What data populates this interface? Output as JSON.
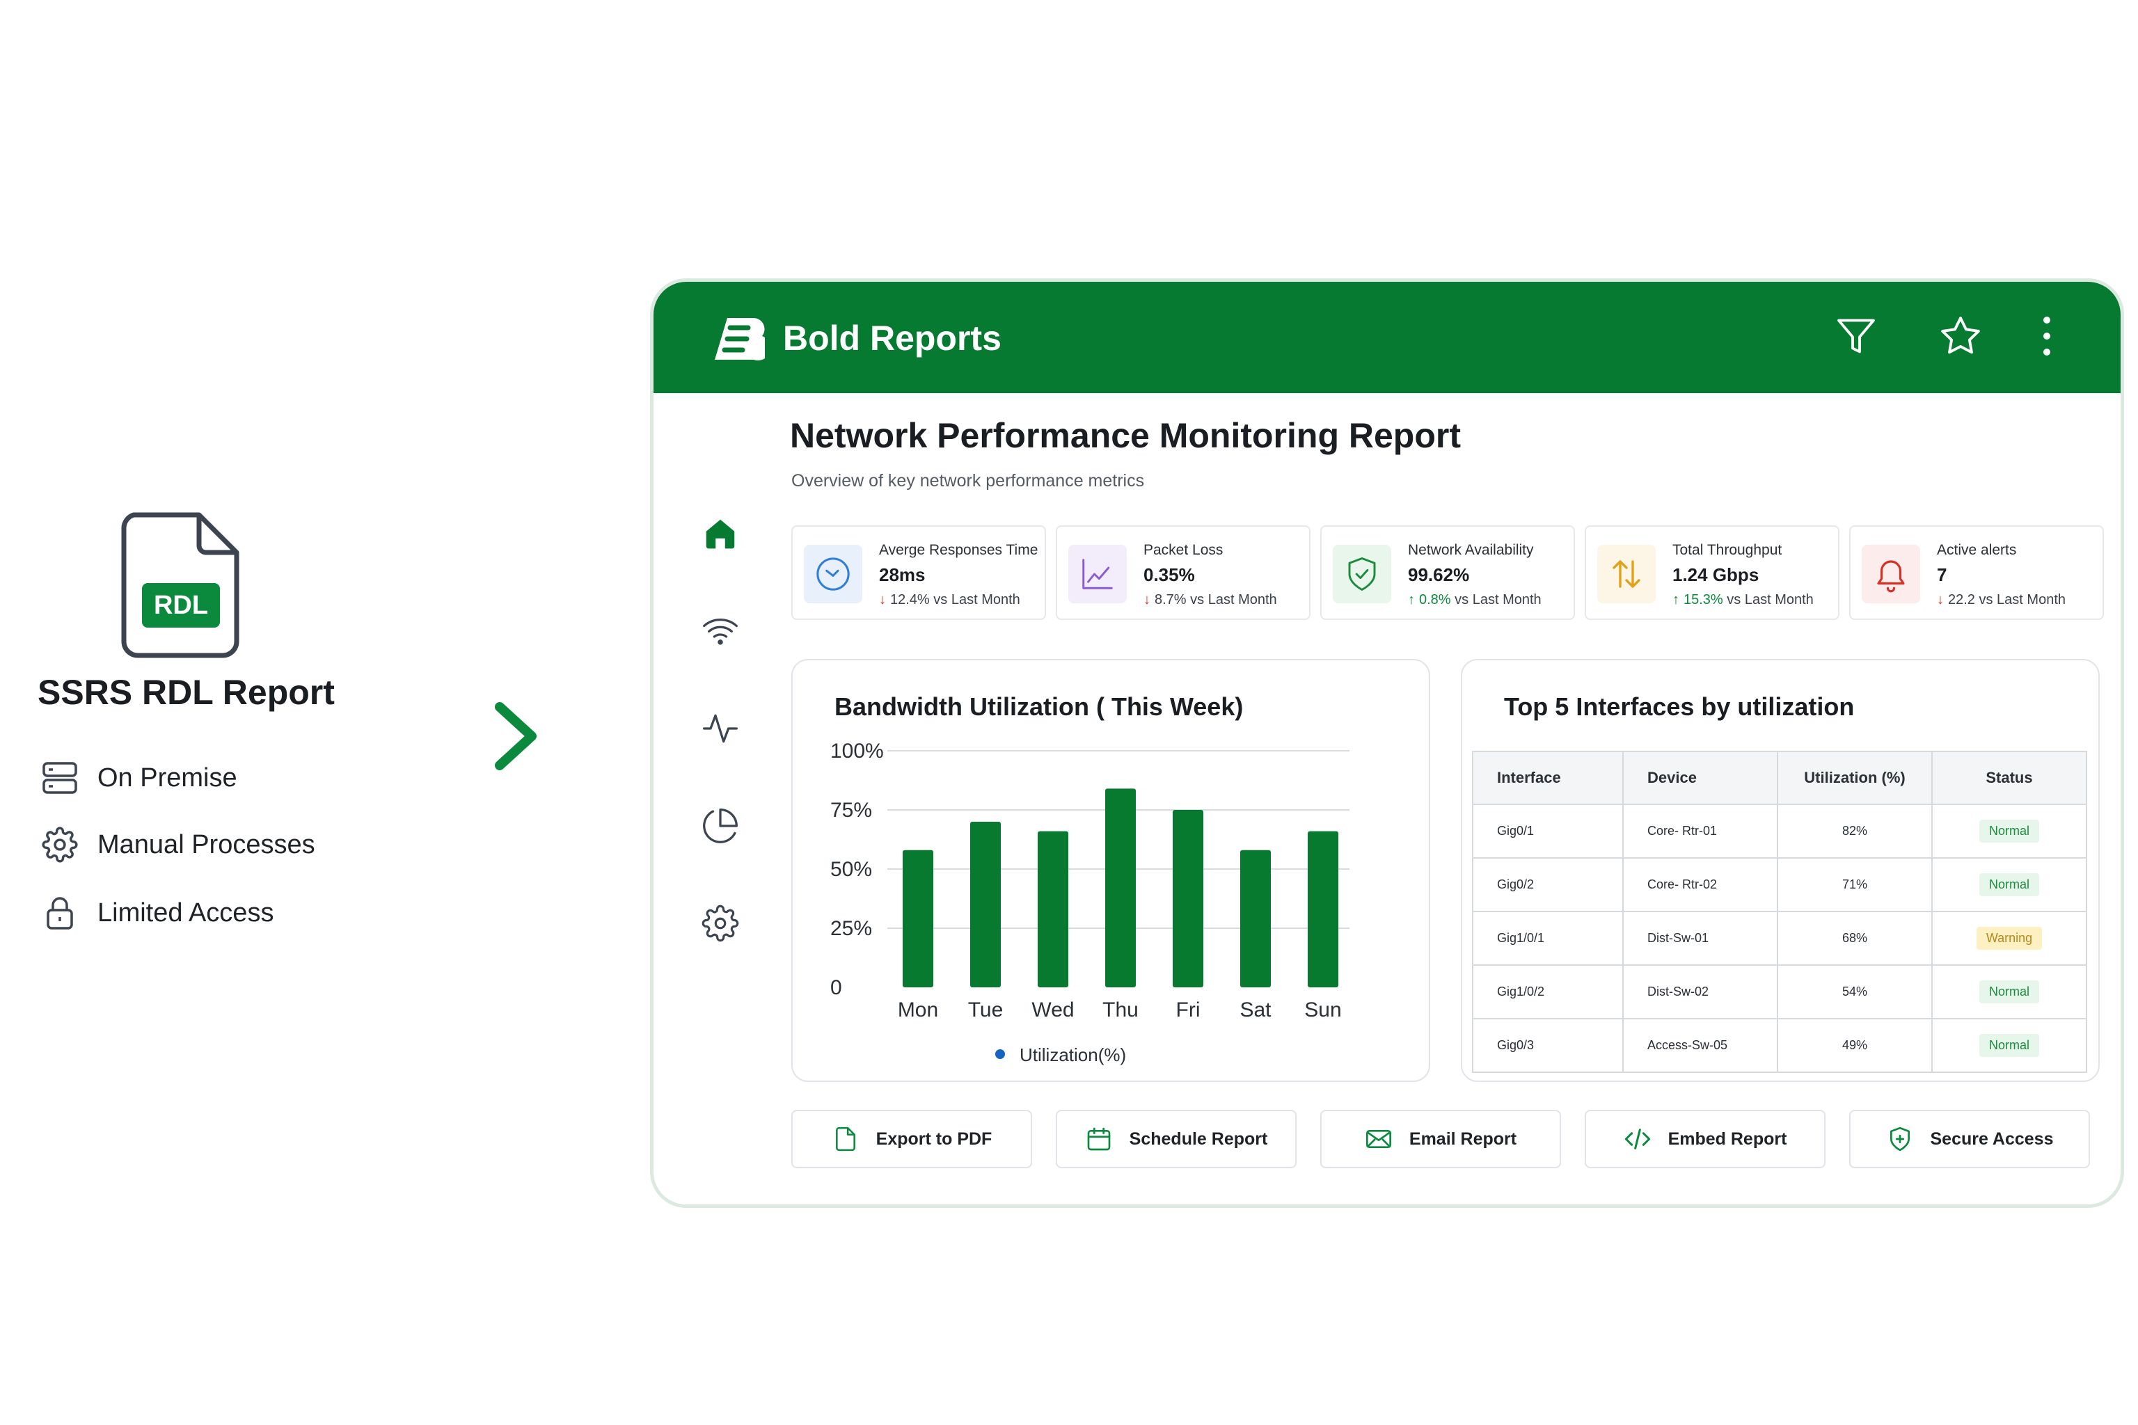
{
  "left": {
    "doc_badge": "RDL",
    "title": "SSRS RDL Report",
    "features": [
      {
        "icon": "server-icon",
        "label": "On Premise"
      },
      {
        "icon": "gear-icon",
        "label": "Manual Processes"
      },
      {
        "icon": "lock-icon",
        "label": "Limited Access"
      }
    ]
  },
  "app": {
    "title": "Bold Reports",
    "brand_color": "#077a32",
    "toolbar_icons": [
      "filter-icon",
      "star-icon",
      "more-vertical-icon"
    ],
    "sidebar_icons": [
      "home-icon",
      "wifi-icon",
      "activity-icon",
      "pie-chart-icon",
      "settings-icon"
    ]
  },
  "report": {
    "title": "Network Performance Monitoring Report",
    "subtitle": "Overview of key network performance metrics"
  },
  "kpis": [
    {
      "label": "Averge Responses Time",
      "value": "28ms",
      "delta": "12.4%",
      "delta_suffix": " vs Last Month",
      "direction": "down",
      "icon": "clock-icon"
    },
    {
      "label": "Packet Loss",
      "value": "0.35%",
      "delta": "8.7%",
      "delta_suffix": " vs Last Month",
      "direction": "down",
      "icon": "line-chart-icon"
    },
    {
      "label": "Network Availability",
      "value": "99.62%",
      "delta": "0.8%",
      "delta_suffix": " vs Last Month",
      "direction": "up",
      "icon": "shield-check-icon"
    },
    {
      "label": "Total Throughput",
      "value": "1.24 Gbps",
      "delta": "15.3%",
      "delta_suffix": " vs Last Month",
      "direction": "up",
      "icon": "transfer-icon"
    },
    {
      "label": "Active alerts",
      "value": "7",
      "delta": "22.2",
      "delta_suffix": " vs Last Month",
      "direction": "down",
      "icon": "bell-icon"
    }
  ],
  "chart_data": {
    "type": "bar",
    "title": "Bandwidth Utilization ( This Week)",
    "categories": [
      "Mon",
      "Tue",
      "Wed",
      "Thu",
      "Fri",
      "Sat",
      "Sun"
    ],
    "series": [
      {
        "name": "Utilization(%)",
        "values": [
          58,
          70,
          66,
          84,
          75,
          58,
          66
        ]
      }
    ],
    "ylim": [
      0,
      100
    ],
    "yticks": [
      "0",
      "25%",
      "50%",
      "75%",
      "100%"
    ],
    "legend": "bottom",
    "grid": true,
    "bar_color": "#087a30",
    "legend_color": "#1565c0"
  },
  "interfaces": {
    "title": "Top 5 Interfaces by utilization",
    "columns": [
      "Interface",
      "Device",
      "Utilization (%)",
      "Status"
    ],
    "rows": [
      {
        "interface": "Gig0/1",
        "device": "Core- Rtr-01",
        "util": "82%",
        "status": "Normal"
      },
      {
        "interface": "Gig0/2",
        "device": "Core- Rtr-02",
        "util": "71%",
        "status": "Normal"
      },
      {
        "interface": "Gig1/0/1",
        "device": "Dist-Sw-01",
        "util": "68%",
        "status": "Warning"
      },
      {
        "interface": "Gig1/0/2",
        "device": "Dist-Sw-02",
        "util": "54%",
        "status": "Normal"
      },
      {
        "interface": "Gig0/3",
        "device": "Access-Sw-05",
        "util": "49%",
        "status": "Normal"
      }
    ]
  },
  "actions": [
    {
      "label": "Export to PDF",
      "icon": "file-icon"
    },
    {
      "label": "Schedule Report",
      "icon": "calendar-icon"
    },
    {
      "label": "Email Report",
      "icon": "mail-icon"
    },
    {
      "label": "Embed Report",
      "icon": "code-icon"
    },
    {
      "label": "Secure Access",
      "icon": "shield-plus-icon"
    }
  ]
}
